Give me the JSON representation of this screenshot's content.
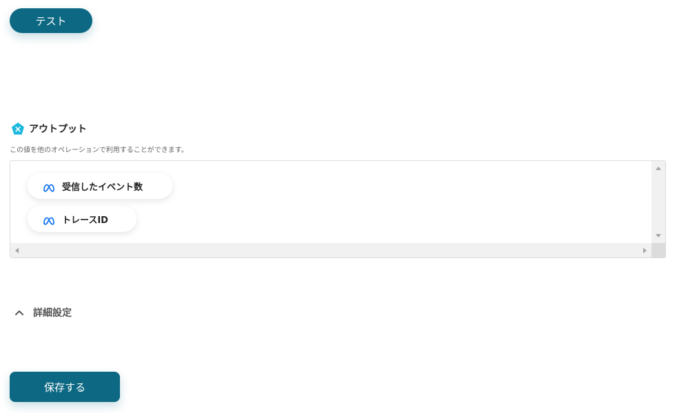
{
  "buttons": {
    "test_label": "テスト",
    "save_label": "保存する"
  },
  "output": {
    "title": "アウトプット",
    "description": "この値を他のオペレーションで利用することができます。",
    "items": [
      {
        "label": "受信したイベント数",
        "icon": "meta-icon"
      },
      {
        "label": "トレースID",
        "icon": "meta-icon"
      }
    ]
  },
  "advanced": {
    "label": "詳細設定",
    "icon": "chevron-up-icon"
  },
  "colors": {
    "primary": "#0d6983",
    "output_icon": "#1cb9dd",
    "meta_blue": "#1877f2"
  }
}
